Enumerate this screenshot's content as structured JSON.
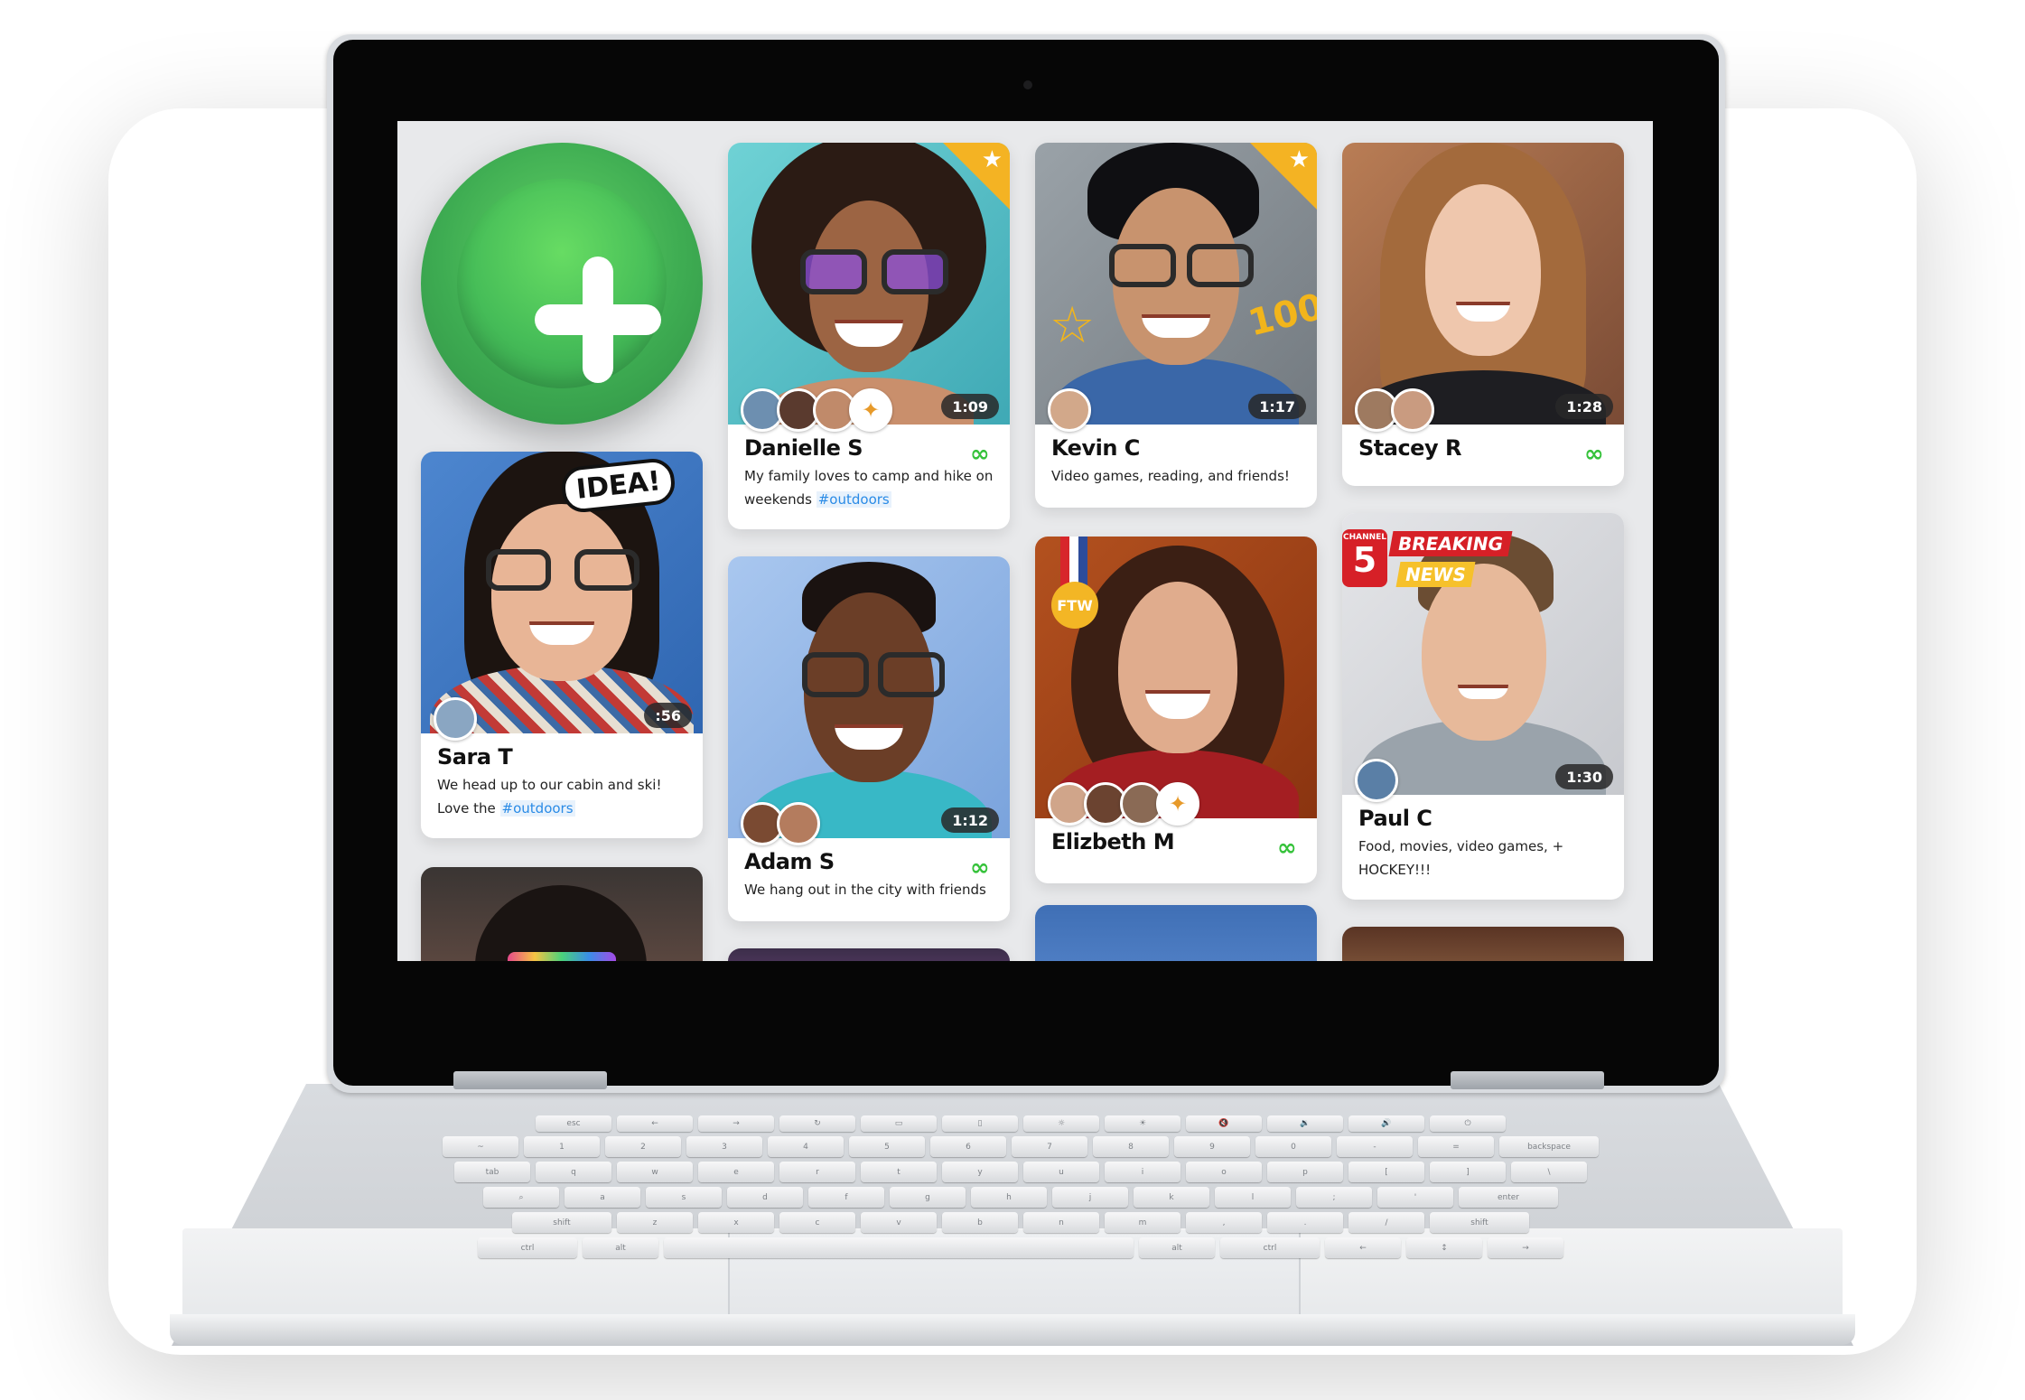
{
  "new_button": {
    "icon": "plus-icon"
  },
  "cards": [
    {
      "name": "Sara T",
      "duration": ":56",
      "desc": "We head up to our cabin and ski! Love the",
      "hashtag": "#outdoors",
      "sticker": "IDEA!"
    },
    {
      "name": "Danielle S",
      "duration": "1:09",
      "desc": "My family loves to camp and hike on weekends",
      "hashtag": "#outdoors"
    },
    {
      "name": "Kevin C",
      "duration": "1:17",
      "desc": "Video games, reading, and friends!",
      "sticker": "100"
    },
    {
      "name": "Stacey R",
      "duration": "1:28"
    },
    {
      "name": "Adam S",
      "duration": "1:12",
      "desc": "We hang out in the city with friends"
    },
    {
      "name": "Elizbeth M",
      "sticker": "FTW"
    },
    {
      "name": "Paul C",
      "duration": "1:30",
      "desc": "Food, movies, video games, + HOCKEY!!!",
      "sticker_channel": "CHANNEL",
      "sticker_number": "5",
      "sticker_top": "BREAKING",
      "sticker_bottom": "NEWS"
    }
  ],
  "colors": {
    "accent_green": "#46bd58",
    "star_gold": "#f4b323",
    "link_green": "#35c23a",
    "hashtag_blue": "#2a8be6"
  },
  "keyboard": {
    "row1": [
      "esc",
      "←",
      "→",
      "↻",
      "▭",
      "▯",
      "☼",
      "☀",
      "🔇",
      "🔉",
      "🔊",
      "⏻"
    ],
    "row2": [
      "~",
      "1",
      "2",
      "3",
      "4",
      "5",
      "6",
      "7",
      "8",
      "9",
      "0",
      "-",
      "=",
      "backspace"
    ],
    "row3": [
      "tab",
      "q",
      "w",
      "e",
      "r",
      "t",
      "y",
      "u",
      "i",
      "o",
      "p",
      "[",
      "]",
      "\\"
    ],
    "row4": [
      "⌕",
      "a",
      "s",
      "d",
      "f",
      "g",
      "h",
      "j",
      "k",
      "l",
      ";",
      "'",
      "enter"
    ],
    "row5": [
      "shift",
      "z",
      "x",
      "c",
      "v",
      "b",
      "n",
      "m",
      ",",
      ".",
      "/",
      "shift"
    ],
    "row6": [
      "ctrl",
      "alt",
      "",
      "alt",
      "ctrl",
      "←",
      "↕",
      "→"
    ]
  }
}
